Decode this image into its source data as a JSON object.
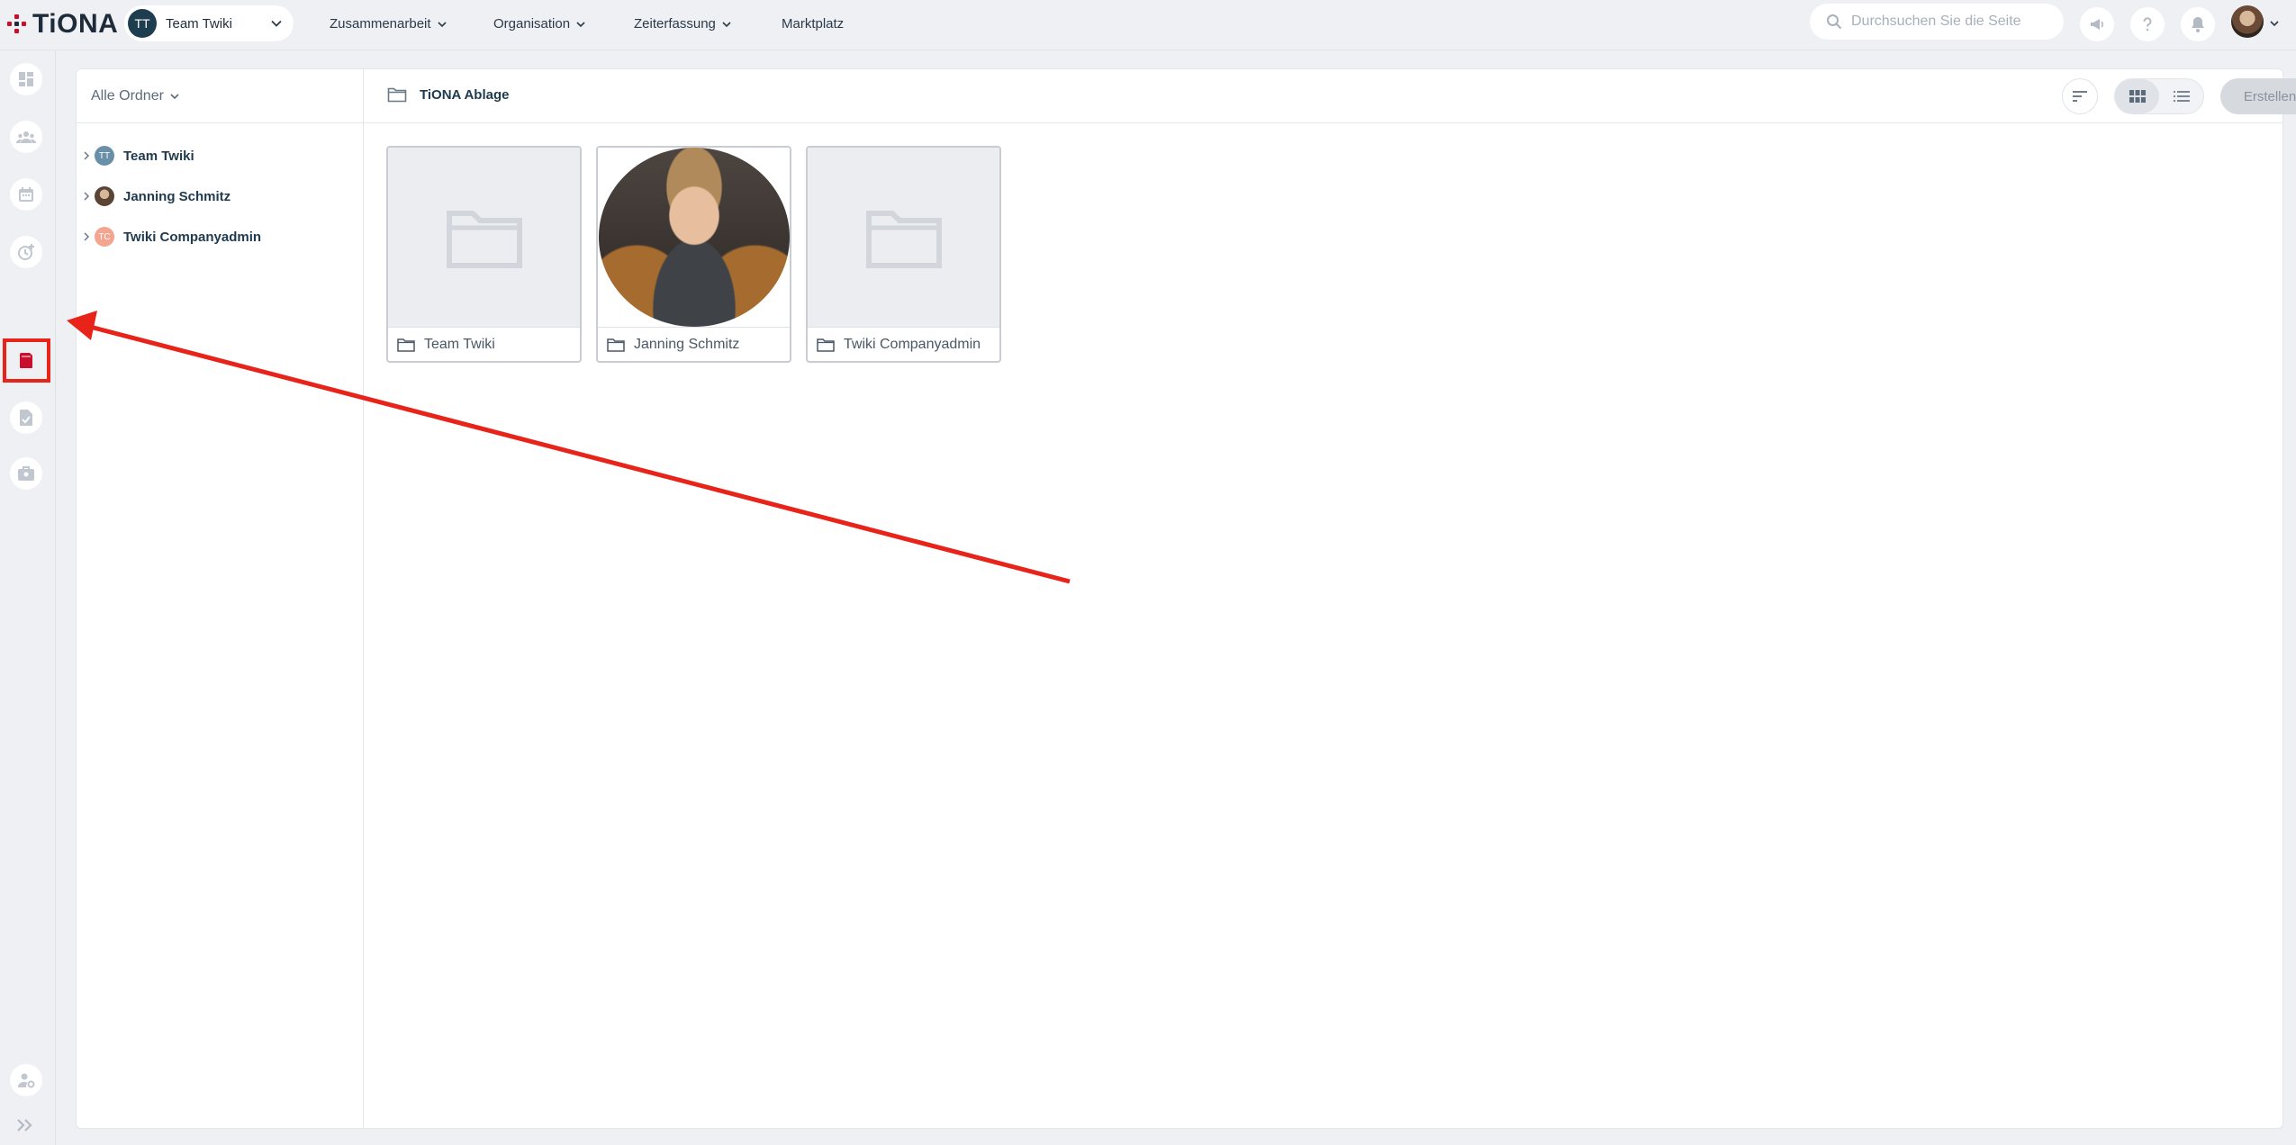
{
  "app": {
    "logo_text": "TiONA"
  },
  "topbar": {
    "team": {
      "initials": "TT",
      "name": "Team Twiki"
    },
    "nav": [
      {
        "label": "Zusammenarbeit"
      },
      {
        "label": "Organisation"
      },
      {
        "label": "Zeiterfassung"
      },
      {
        "label": "Marktplatz"
      }
    ],
    "search": {
      "placeholder": "Durchsuchen Sie die Seite"
    },
    "icons": [
      "megaphone-icon",
      "help-icon",
      "bell-icon"
    ]
  },
  "rail": {
    "items": [
      "dashboard-icon",
      "team-icon",
      "calendar-icon",
      "time-tracking-icon",
      "storage-icon",
      "document-check-icon",
      "briefcase-icon"
    ],
    "active": "storage-icon",
    "bottom": [
      "user-settings-icon",
      "expand-icon"
    ]
  },
  "tree": {
    "header": "Alle Ordner",
    "items": [
      {
        "initials": "TT",
        "name": "Team Twiki",
        "color": "#6a8fa8"
      },
      {
        "initials": "",
        "name": "Janning Schmitz",
        "color": "#5a4436"
      },
      {
        "initials": "TC",
        "name": "Twiki Companyadmin",
        "color": "#f4a58f"
      }
    ]
  },
  "content": {
    "breadcrumb": "TiONA Ablage",
    "create_label": "Erstellen",
    "cards": [
      {
        "name": "Team Twiki",
        "type": "folder"
      },
      {
        "name": "Janning Schmitz",
        "type": "photo"
      },
      {
        "name": "Twiki Companyadmin",
        "type": "folder"
      }
    ]
  },
  "colors": {
    "accent": "#e8231a",
    "brand_red": "#c8102e",
    "dark": "#1e3d4f"
  }
}
